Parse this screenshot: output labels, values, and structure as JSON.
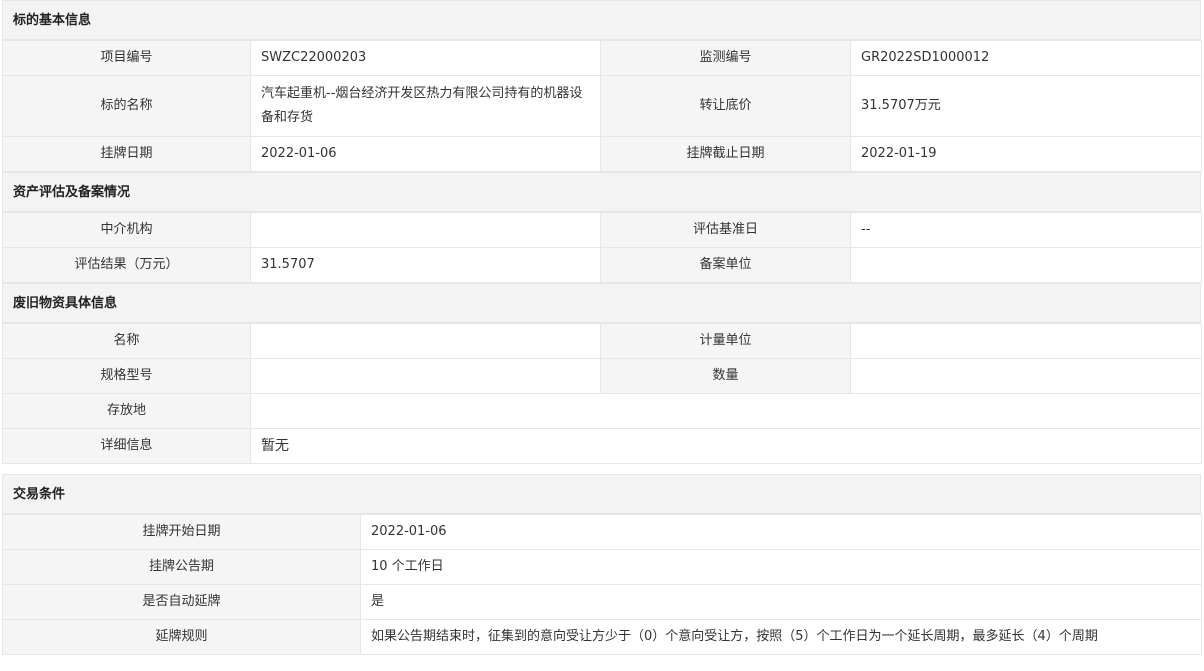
{
  "basic": {
    "title": "标的基本信息",
    "project_no_label": "项目编号",
    "project_no": "SWZC22000203",
    "monitor_no_label": "监测编号",
    "monitor_no": "GR2022SD1000012",
    "name_label": "标的名称",
    "name": "汽车起重机--烟台经济开发区热力有限公司持有的机器设备和存货",
    "price_label": "转让底价",
    "price": "31.5707万元",
    "list_date_label": "挂牌日期",
    "list_date": "2022-01-06",
    "end_date_label": "挂牌截止日期",
    "end_date": "2022-01-19"
  },
  "assessment": {
    "title": "资产评估及备案情况",
    "agency_label": "中介机构",
    "agency": "",
    "base_date_label": "评估基准日",
    "base_date": "--",
    "result_label": "评估结果（万元）",
    "result": "31.5707",
    "filing_label": "备案单位",
    "filing": ""
  },
  "waste": {
    "title": "废旧物资具体信息",
    "name_label": "名称",
    "name": "",
    "unit_label": "计量单位",
    "unit": "",
    "spec_label": "规格型号",
    "spec": "",
    "qty_label": "数量",
    "qty": "",
    "location_label": "存放地",
    "location": "",
    "detail_label": "详细信息",
    "detail": "暂无"
  },
  "trade": {
    "title": "交易条件",
    "start_label": "挂牌开始日期",
    "start": "2022-01-06",
    "period_label": "挂牌公告期",
    "period": "10 个工作日",
    "auto_label": "是否自动延牌",
    "auto": "是",
    "rule_label": "延牌规则",
    "rule": "如果公告期结束时，征集到的意向受让方少于（0）个意向受让方，按照（5）个工作日为一个延长周期，最多延长（4）个周期"
  }
}
